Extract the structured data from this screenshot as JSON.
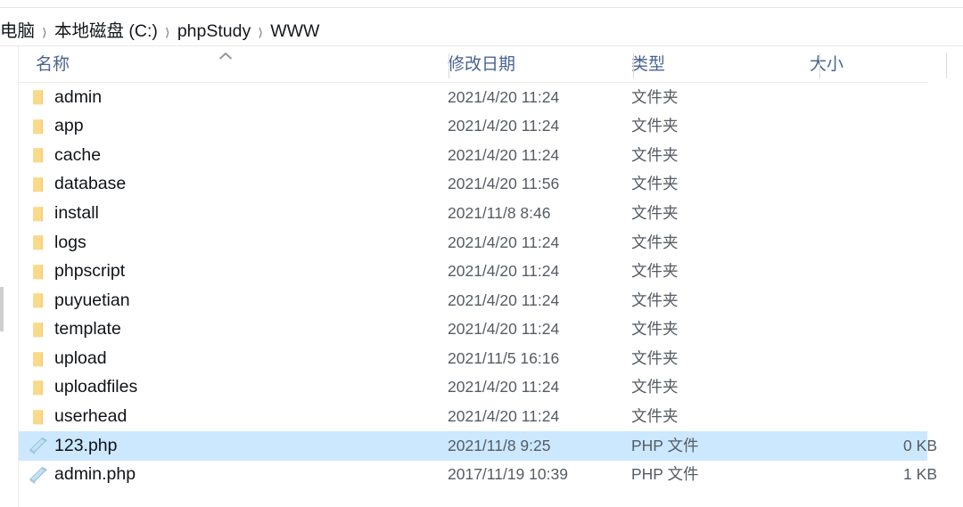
{
  "window": {
    "app": "file-explorer",
    "accent_selection_color": "#cce8ff",
    "header_text_color": "#4a6490"
  },
  "breadcrumb": {
    "separator": "❯",
    "items": [
      {
        "label": "电脑"
      },
      {
        "label": "本地磁盘 (C:)"
      },
      {
        "label": "phpStudy"
      },
      {
        "label": "WWW"
      }
    ]
  },
  "columns": {
    "sort_indicator": "chevron-up-icon",
    "sorted_by": "名称",
    "headers": [
      {
        "key": "name",
        "label": "名称"
      },
      {
        "key": "date",
        "label": "修改日期"
      },
      {
        "key": "type",
        "label": "类型"
      },
      {
        "key": "size",
        "label": "大小"
      }
    ]
  },
  "files": [
    {
      "name": "admin",
      "date": "2021/4/20 11:24",
      "type": "文件夹",
      "size": "",
      "icon": "folder-icon",
      "selected": false
    },
    {
      "name": "app",
      "date": "2021/4/20 11:24",
      "type": "文件夹",
      "size": "",
      "icon": "folder-icon",
      "selected": false
    },
    {
      "name": "cache",
      "date": "2021/4/20 11:24",
      "type": "文件夹",
      "size": "",
      "icon": "folder-icon",
      "selected": false
    },
    {
      "name": "database",
      "date": "2021/4/20 11:56",
      "type": "文件夹",
      "size": "",
      "icon": "folder-icon",
      "selected": false
    },
    {
      "name": "install",
      "date": "2021/11/8 8:46",
      "type": "文件夹",
      "size": "",
      "icon": "folder-icon",
      "selected": false
    },
    {
      "name": "logs",
      "date": "2021/4/20 11:24",
      "type": "文件夹",
      "size": "",
      "icon": "folder-icon",
      "selected": false
    },
    {
      "name": "phpscript",
      "date": "2021/4/20 11:24",
      "type": "文件夹",
      "size": "",
      "icon": "folder-icon",
      "selected": false
    },
    {
      "name": "puyuetian",
      "date": "2021/4/20 11:24",
      "type": "文件夹",
      "size": "",
      "icon": "folder-icon",
      "selected": false
    },
    {
      "name": "template",
      "date": "2021/4/20 11:24",
      "type": "文件夹",
      "size": "",
      "icon": "folder-icon",
      "selected": false
    },
    {
      "name": "upload",
      "date": "2021/11/5 16:16",
      "type": "文件夹",
      "size": "",
      "icon": "folder-icon",
      "selected": false
    },
    {
      "name": "uploadfiles",
      "date": "2021/4/20 11:24",
      "type": "文件夹",
      "size": "",
      "icon": "folder-icon",
      "selected": false
    },
    {
      "name": "userhead",
      "date": "2021/4/20 11:24",
      "type": "文件夹",
      "size": "",
      "icon": "folder-icon",
      "selected": false
    },
    {
      "name": "123.php",
      "date": "2021/11/8 9:25",
      "type": "PHP 文件",
      "size": "0 KB",
      "icon": "php-file-icon",
      "selected": true
    },
    {
      "name": "admin.php",
      "date": "2017/11/19 10:39",
      "type": "PHP 文件",
      "size": "1 KB",
      "icon": "php-file-icon",
      "selected": false
    }
  ]
}
